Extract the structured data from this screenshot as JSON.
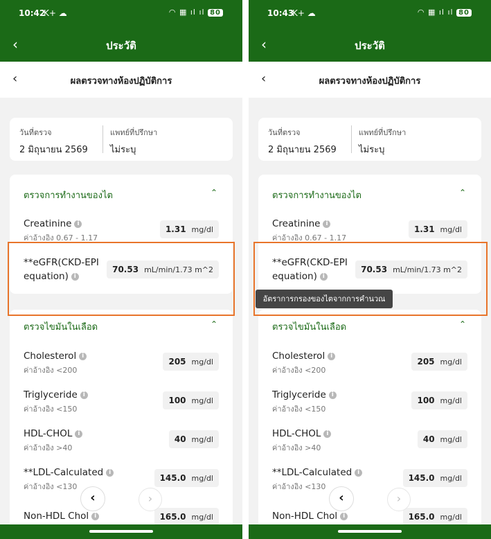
{
  "screens": [
    {
      "status": {
        "time": "10:42",
        "left_icons": "K+ ☁",
        "right_icons": "◠ ▦ ıl ıl",
        "battery": "80"
      },
      "app_title": "ประวัติ",
      "sub_title": "ผลตรวจทางห้องปฏิบัติการ",
      "info": {
        "date_label": "วันที่ตรวจ",
        "date_value": "2 มิถุนายน 2569",
        "doctor_label": "แพทย์ที่ปรึกษา",
        "doctor_value": "ไม่ระบุ"
      },
      "kidney": {
        "title": "ตรวจการทำงานของไต",
        "creatinine": {
          "name": "Creatinine",
          "ref": "ค่าอ้างอิง 0.67 - 1.17",
          "value": "1.31",
          "unit": "mg/dl"
        },
        "egfr": {
          "name": "**eGFR(CKD-EPI equation)",
          "value": "70.53",
          "unit": "mL/min/1.73 m^2"
        }
      },
      "lipid": {
        "title": "ตรวจไขมันในเลือด",
        "cholesterol": {
          "name": "Cholesterol",
          "ref": "ค่าอ้างอิง <200",
          "value": "205",
          "unit": "mg/dl"
        },
        "triglyceride": {
          "name": "Triglyceride",
          "ref": "ค่าอ้างอิง <150",
          "value": "100",
          "unit": "mg/dl"
        },
        "hdl": {
          "name": "HDL-CHOL",
          "ref": "ค่าอ้างอิง >40",
          "value": "40",
          "unit": "mg/dl"
        },
        "ldl": {
          "name": "**LDL-Calculated",
          "ref": "ค่าอ้างอิง <130",
          "value": "145.0",
          "unit": "mg/dl"
        },
        "nonhdl": {
          "name": "Non-HDL Chol",
          "value": "165.0",
          "unit": "mg/dl"
        }
      }
    },
    {
      "status": {
        "time": "10:43",
        "left_icons": "K+ ☁",
        "right_icons": "◠ ▦ ıl ıl",
        "battery": "80"
      },
      "app_title": "ประวัติ",
      "sub_title": "ผลตรวจทางห้องปฏิบัติการ",
      "info": {
        "date_label": "วันที่ตรวจ",
        "date_value": "2 มิถุนายน 2569",
        "doctor_label": "แพทย์ที่ปรึกษา",
        "doctor_value": "ไม่ระบุ"
      },
      "kidney": {
        "title": "ตรวจการทำงานของไต",
        "creatinine": {
          "name": "Creatinine",
          "ref": "ค่าอ้างอิง 0.67 - 1.17",
          "value": "1.31",
          "unit": "mg/dl"
        },
        "egfr": {
          "name": "**eGFR(CKD-EPI equation)",
          "value": "70.53",
          "unit": "mL/min/1.73 m^2"
        }
      },
      "tooltip": "อัตราการกรองของไตจากการคำนวณ",
      "lipid": {
        "title": "ตรวจไขมันในเลือด",
        "cholesterol": {
          "name": "Cholesterol",
          "ref": "ค่าอ้างอิง <200",
          "value": "205",
          "unit": "mg/dl"
        },
        "triglyceride": {
          "name": "Triglyceride",
          "ref": "ค่าอ้างอิง <150",
          "value": "100",
          "unit": "mg/dl"
        },
        "hdl": {
          "name": "HDL-CHOL",
          "ref": "ค่าอ้างอิง >40",
          "value": "40",
          "unit": "mg/dl"
        },
        "ldl": {
          "name": "**LDL-Calculated",
          "ref": "ค่าอ้างอิง <130",
          "value": "145.0",
          "unit": "mg/dl"
        },
        "nonhdl": {
          "name": "Non-HDL Chol",
          "value": "165.0",
          "unit": "mg/dl"
        }
      }
    }
  ],
  "icons": {
    "back": "chevron-left",
    "info": "info-circle",
    "collapse": "chevron-up",
    "next": "chevron-right"
  },
  "colors": {
    "brand_green": "#1b6a17",
    "highlight_orange": "#e8742a"
  }
}
